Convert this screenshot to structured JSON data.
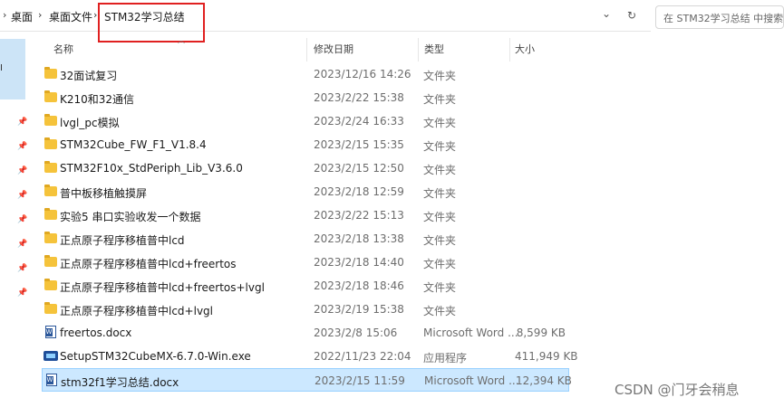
{
  "address_bar": {
    "breadcrumbs": [
      "桌面",
      "桌面文件",
      "STM32学习总结"
    ],
    "separator": "›",
    "dropdown_glyph": "⌄",
    "refresh_glyph": "↻"
  },
  "search": {
    "placeholder": "在 STM32学习总结 中搜索"
  },
  "columns": {
    "name": "名称",
    "date": "修改日期",
    "type": "类型",
    "size": "大小"
  },
  "files": [
    {
      "name": "32面试复习",
      "date": "2023/12/16 14:26",
      "type": "文件夹",
      "size": "",
      "icon": "folder-icon"
    },
    {
      "name": "K210和32通信",
      "date": "2023/2/22 15:38",
      "type": "文件夹",
      "size": "",
      "icon": "folder-icon"
    },
    {
      "name": "lvgl_pc模拟",
      "date": "2023/2/24 16:33",
      "type": "文件夹",
      "size": "",
      "icon": "folder-icon"
    },
    {
      "name": "STM32Cube_FW_F1_V1.8.4",
      "date": "2023/2/15 15:35",
      "type": "文件夹",
      "size": "",
      "icon": "folder-icon"
    },
    {
      "name": "STM32F10x_StdPeriph_Lib_V3.6.0",
      "date": "2023/2/15 12:50",
      "type": "文件夹",
      "size": "",
      "icon": "folder-icon"
    },
    {
      "name": "普中板移植触摸屏",
      "date": "2023/2/18 12:59",
      "type": "文件夹",
      "size": "",
      "icon": "folder-icon"
    },
    {
      "name": "实验5 串口实验收发一个数据",
      "date": "2023/2/22 15:13",
      "type": "文件夹",
      "size": "",
      "icon": "folder-icon"
    },
    {
      "name": "正点原子程序移植普中lcd",
      "date": "2023/2/18 13:38",
      "type": "文件夹",
      "size": "",
      "icon": "folder-icon"
    },
    {
      "name": "正点原子程序移植普中lcd+freertos",
      "date": "2023/2/18 14:40",
      "type": "文件夹",
      "size": "",
      "icon": "folder-icon"
    },
    {
      "name": "正点原子程序移植普中lcd+freertos+lvgl",
      "date": "2023/2/18 18:46",
      "type": "文件夹",
      "size": "",
      "icon": "folder-icon"
    },
    {
      "name": "正点原子程序移植普中lcd+lvgl",
      "date": "2023/2/19 15:38",
      "type": "文件夹",
      "size": "",
      "icon": "folder-icon"
    },
    {
      "name": "freertos.docx",
      "date": "2023/2/8 15:06",
      "type": "Microsoft Word ...",
      "size": "8,599 KB",
      "icon": "word-document-icon"
    },
    {
      "name": "SetupSTM32CubeMX-6.7.0-Win.exe",
      "date": "2022/11/23 22:04",
      "type": "应用程序",
      "size": "411,949 KB",
      "icon": "installer-icon"
    },
    {
      "name": "stm32f1学习总结.docx",
      "date": "2023/2/15 11:59",
      "type": "Microsoft Word ...",
      "size": "12,394 KB",
      "icon": "word-document-icon",
      "selected": true
    }
  ],
  "nav_pane": {
    "pin_glyph": "📌",
    "left_marker": "I"
  },
  "watermark": "CSDN @门牙会稍息",
  "colors": {
    "selection": "#cce8ff",
    "selection_border": "#99d1ff",
    "highlight_box": "#e02020",
    "folder": "#f5c33b"
  }
}
